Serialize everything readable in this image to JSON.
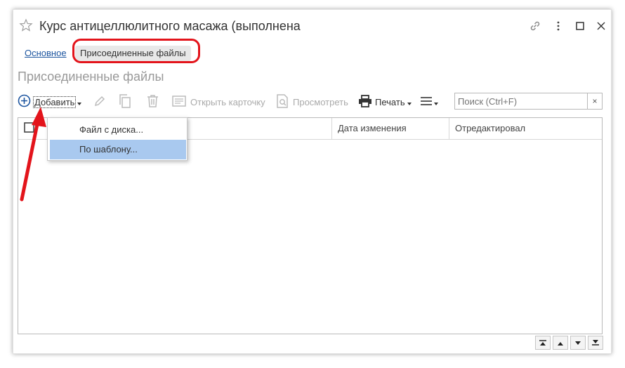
{
  "window": {
    "title": "Курс антицеллюлитного масажа (выполнена"
  },
  "titlebar_icons": [
    "star-icon",
    "link-icon",
    "more-icon",
    "maximize-icon",
    "close-icon"
  ],
  "navigation": {
    "main_link": "Основное",
    "active_item": "Присоединенные файлы"
  },
  "section": {
    "title": "Присоединенные файлы"
  },
  "toolbar": {
    "add_label": "Добавить",
    "open_card_label": "Открыть карточку",
    "view_label": "Просмотреть",
    "print_label": "Печать"
  },
  "search": {
    "placeholder": "Поиск (Ctrl+F)",
    "clear_label": "×"
  },
  "dropdown": {
    "items": [
      {
        "label": "Файл с диска..."
      },
      {
        "label": "По шаблону..."
      }
    ],
    "selected_index": 1
  },
  "table": {
    "columns": [
      "",
      "Дата изменения",
      "Отредактировал"
    ],
    "rows": []
  },
  "colors": {
    "accent_blue": "#1e56a0",
    "highlight_red": "#e3141b",
    "selection": "#a9c9ef"
  }
}
